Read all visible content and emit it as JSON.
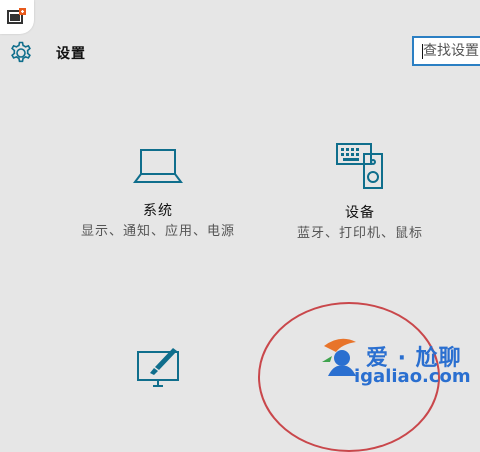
{
  "header": {
    "title": "设置",
    "app_icon": "app-badge-icon",
    "settings_icon": "gear-icon"
  },
  "search": {
    "placeholder": "查找设置"
  },
  "categories": [
    {
      "id": "system",
      "title": "系统",
      "description": "显示、通知、应用、电源",
      "icon": "laptop-icon"
    },
    {
      "id": "devices",
      "title": "设备",
      "description": "蓝牙、打印机、鼠标",
      "icon": "keyboard-speaker-icon"
    },
    {
      "id": "personalization",
      "title": "",
      "description": "",
      "icon": "paintbrush-monitor-icon"
    }
  ],
  "watermark": {
    "name": "爱 · 尬聊",
    "url": "igaliao.com"
  },
  "colors": {
    "accent": "#0f6e8c",
    "search_border": "#2b7fc3",
    "background": "#e6e6e6",
    "watermark_circle": "#c9474b",
    "watermark_text": "#2a6fd0"
  }
}
